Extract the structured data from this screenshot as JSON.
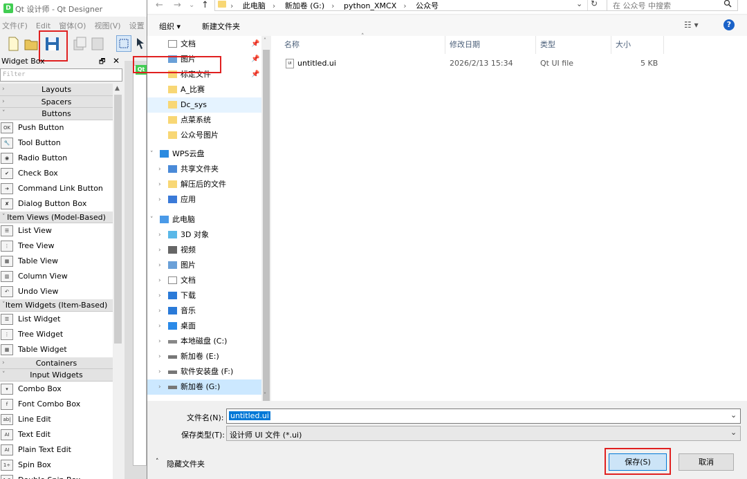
{
  "qt": {
    "title": "Qt 设计师 - Qt Designer",
    "menu": [
      "文件(F)",
      "Edit",
      "窗体(O)",
      "视图(V)",
      "设置"
    ],
    "widget_box_title": "Widget Box",
    "filter_placeholder": "Filter",
    "widget_box": [
      {
        "type": "cat",
        "label": "Layouts"
      },
      {
        "type": "cat",
        "label": "Spacers"
      },
      {
        "type": "cat",
        "label": "Buttons"
      },
      {
        "type": "item",
        "label": "Push Button",
        "icon": "OK"
      },
      {
        "type": "item",
        "label": "Tool Button",
        "icon": "🔧"
      },
      {
        "type": "item",
        "label": "Radio Button",
        "icon": "◉"
      },
      {
        "type": "item",
        "label": "Check Box",
        "icon": "✔"
      },
      {
        "type": "item",
        "label": "Command Link Button",
        "icon": "➔"
      },
      {
        "type": "item",
        "label": "Dialog Button Box",
        "icon": "✘"
      },
      {
        "type": "cat",
        "label": "Item Views (Model-Based)"
      },
      {
        "type": "item",
        "label": "List View",
        "icon": "☰"
      },
      {
        "type": "item",
        "label": "Tree View",
        "icon": "⋮"
      },
      {
        "type": "item",
        "label": "Table View",
        "icon": "▦"
      },
      {
        "type": "item",
        "label": "Column View",
        "icon": "▥"
      },
      {
        "type": "item",
        "label": "Undo View",
        "icon": "↶"
      },
      {
        "type": "cat",
        "label": "Item Widgets (Item-Based)"
      },
      {
        "type": "item",
        "label": "List Widget",
        "icon": "☰"
      },
      {
        "type": "item",
        "label": "Tree Widget",
        "icon": "⋮"
      },
      {
        "type": "item",
        "label": "Table Widget",
        "icon": "▦"
      },
      {
        "type": "cat",
        "label": "Containers"
      },
      {
        "type": "cat",
        "label": "Input Widgets"
      },
      {
        "type": "item",
        "label": "Combo Box",
        "icon": "▾"
      },
      {
        "type": "item",
        "label": "Font Combo Box",
        "icon": "f"
      },
      {
        "type": "item",
        "label": "Line Edit",
        "icon": "ab|"
      },
      {
        "type": "item",
        "label": "Text Edit",
        "icon": "AI"
      },
      {
        "type": "item",
        "label": "Plain Text Edit",
        "icon": "AI"
      },
      {
        "type": "item",
        "label": "Spin Box",
        "icon": "1÷"
      },
      {
        "type": "item",
        "label": "Double Spin Box",
        "icon": "1.2"
      }
    ]
  },
  "dialog": {
    "breadcrumbs": [
      "此电脑",
      "新加卷 (G:)",
      "python_XMCX",
      "公众号"
    ],
    "search_placeholder": "在 公众号 中搜索",
    "organize": "组织 ▾",
    "new_folder": "新建文件夹",
    "nav": [
      {
        "label": "文档",
        "kind": "doc",
        "pin": true,
        "indent": 1
      },
      {
        "label": "图片",
        "kind": "img",
        "pin": true,
        "indent": 1
      },
      {
        "label": "标定文件",
        "kind": "folder",
        "pin": true,
        "indent": 1
      },
      {
        "label": "A_比赛",
        "kind": "folder",
        "indent": 1
      },
      {
        "label": "Dc_sys",
        "kind": "folder",
        "indent": 1,
        "selected": true
      },
      {
        "label": "点菜系统",
        "kind": "folder",
        "indent": 1
      },
      {
        "label": "公众号图片",
        "kind": "folder",
        "indent": 1
      },
      {
        "label": "WPS云盘",
        "kind": "cloud",
        "indent": 0,
        "open": true
      },
      {
        "label": "共享文件夹",
        "kind": "share",
        "indent": 1,
        "chev": true
      },
      {
        "label": "解压后的文件",
        "kind": "folder",
        "indent": 1,
        "chev": true
      },
      {
        "label": "应用",
        "kind": "apps",
        "indent": 1,
        "chev": true
      },
      {
        "label": "此电脑",
        "kind": "pc",
        "indent": 0,
        "open": true
      },
      {
        "label": "3D 对象",
        "kind": "3d",
        "indent": 1,
        "chev": true
      },
      {
        "label": "视频",
        "kind": "video",
        "indent": 1,
        "chev": true
      },
      {
        "label": "图片",
        "kind": "img",
        "indent": 1,
        "chev": true
      },
      {
        "label": "文档",
        "kind": "doc",
        "indent": 1,
        "chev": true
      },
      {
        "label": "下载",
        "kind": "down",
        "indent": 1,
        "chev": true
      },
      {
        "label": "音乐",
        "kind": "music",
        "indent": 1,
        "chev": true
      },
      {
        "label": "桌面",
        "kind": "desk",
        "indent": 1,
        "chev": true
      },
      {
        "label": "本地磁盘 (C:)",
        "kind": "drivec",
        "indent": 1,
        "chev": true
      },
      {
        "label": "新加卷 (E:)",
        "kind": "drive",
        "indent": 1,
        "chev": true
      },
      {
        "label": "软件安装盘 (F:)",
        "kind": "drive",
        "indent": 1,
        "chev": true
      },
      {
        "label": "新加卷 (G:)",
        "kind": "drive",
        "indent": 1,
        "chev": true,
        "selected": true
      }
    ],
    "columns": {
      "name": "名称",
      "date": "修改日期",
      "type": "类型",
      "size": "大小"
    },
    "file": {
      "name": "untitled.ui",
      "date": "2026/2/13 15:34",
      "type": "Qt UI file",
      "size": "5 KB"
    },
    "filename_label": "文件名(N):",
    "filename_value": "untitled.ui",
    "filetype_label": "保存类型(T):",
    "filetype_value": "设计师 UI 文件 (*.ui)",
    "hide_folders": "隐藏文件夹",
    "save": "保存(S)",
    "cancel": "取消"
  },
  "colors": {
    "highlight": "#e02020",
    "accent": "#0078d7",
    "folder": "#f8d775"
  }
}
